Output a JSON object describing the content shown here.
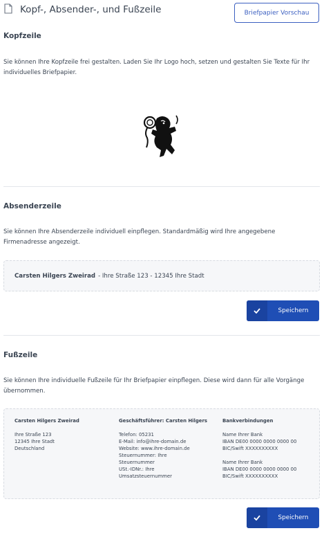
{
  "header": {
    "title": "Kopf-, Absender-, und Fußzeile",
    "preview_button": "Briefpapier Vorschau"
  },
  "kopfzeile": {
    "title": "Kopfzeile",
    "description": "Sie können Ihre Kopfzeile frei gestalten. Laden Sie Ihr Logo hoch, setzen und gestalten Sie Texte für Ihr individuelles Briefpapier."
  },
  "absenderzeile": {
    "title": "Absenderzeile",
    "description": "Sie können Ihre Absenderzeile individuell einpflegen. Standardmäßig wird Ihre angegebene Firmenadresse angezeigt.",
    "company": "Carsten Hilgers Zweirad",
    "address_rest": "- Ihre Straße 123 - 12345 Ihre Stadt",
    "save_button": "Speichern"
  },
  "fusszeile": {
    "title": "Fußzeile",
    "description": "Sie können Ihre individuelle Fußzeile für Ihr Briefpapier einpflegen. Diese wird dann für alle Vorgänge übernommen.",
    "columns": [
      {
        "heading": "Carsten Hilgers Zweirad",
        "lines": [
          "Ihre Straße 123",
          "12345 Ihre Stadt",
          "Deutschland"
        ]
      },
      {
        "heading": "Geschäftsführer: Carsten Hilgers",
        "lines": [
          "Telefon: 05231",
          "E-Mail: info@ihre-domain.de",
          "Website: www.ihre-domain.de",
          "Steuernummer: Ihre",
          "Steuernummer",
          "USt.-IDNr.: Ihre",
          "Umsatzsteuernummer"
        ]
      },
      {
        "heading": "Bankverbindungen",
        "lines": [
          "Name Ihrer Bank",
          "IBAN DE00 0000 0000 0000 00",
          "BIC/Swift XXXXXXXXXX",
          "",
          "Name Ihrer Bank",
          "IBAN DE00 0000 0000 0000 00",
          "BIC/Swift XXXXXXXXXX"
        ]
      }
    ],
    "save_button": "Speichern"
  },
  "icons": {
    "document": "document-icon",
    "check": "check-icon",
    "logo": "lion-logo-icon"
  }
}
